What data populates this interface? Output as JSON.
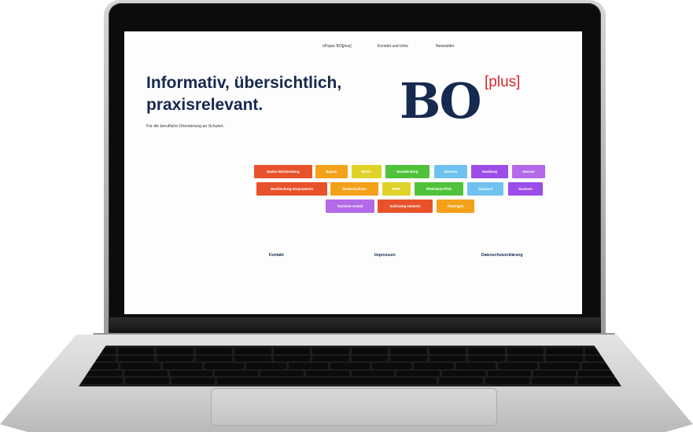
{
  "nav": {
    "items": [
      {
        "label": "ePaper BO[plus]"
      },
      {
        "label": "Kontakt und Infos"
      },
      {
        "label": "Newsletter"
      }
    ]
  },
  "hero": {
    "headline_line1": "Informativ, übersichtlich,",
    "headline_line2": "praxisrelevant.",
    "subline": "Für die berufliche Orientierung an Schulen."
  },
  "logo": {
    "text": "BO",
    "superscript": "[plus]",
    "colors": {
      "main": "#16294f",
      "accent": "#d6262d"
    }
  },
  "states": [
    {
      "label": "Baden-Württemberg",
      "color": "#e8522a"
    },
    {
      "label": "Bayern",
      "color": "#f4a11a"
    },
    {
      "label": "Berlin",
      "color": "#dfd32a"
    },
    {
      "label": "Brandenburg",
      "color": "#4fc23a"
    },
    {
      "label": "Bremen",
      "color": "#6fc2ef"
    },
    {
      "label": "Hamburg",
      "color": "#9c4ce8"
    },
    {
      "label": "Hessen",
      "color": "#b36ae8"
    },
    {
      "label": "Mecklenburg-Vorpommern",
      "color": "#e8522a"
    },
    {
      "label": "Niedersachsen",
      "color": "#f4a11a"
    },
    {
      "label": "NRW",
      "color": "#dfd32a"
    },
    {
      "label": "Rheinland-Pfalz",
      "color": "#4fc23a"
    },
    {
      "label": "Saarland",
      "color": "#6fc2ef"
    },
    {
      "label": "Sachsen",
      "color": "#9c4ce8"
    },
    {
      "label": "Sachsen-Anhalt",
      "color": "#b36ae8"
    },
    {
      "label": "Schleswig-Holstein",
      "color": "#e8522a"
    },
    {
      "label": "Thüringen",
      "color": "#f4a11a"
    }
  ],
  "footer": {
    "links": [
      {
        "label": "Kontakt"
      },
      {
        "label": "Impressum"
      },
      {
        "label": "Datenschutzerklärung"
      }
    ]
  }
}
